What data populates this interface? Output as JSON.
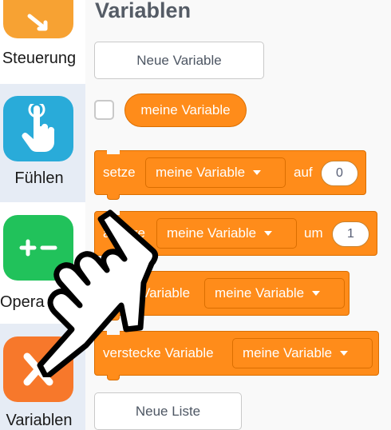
{
  "categories": [
    {
      "label": "Steuerung",
      "color": "#f7a233",
      "icon": "control-icon"
    },
    {
      "label": "Fühlen",
      "color": "#29abd9",
      "icon": "touch-icon"
    },
    {
      "label": "Operatoren",
      "label_visible": "Opera",
      "color": "#21c25b",
      "icon": "operators-icon"
    },
    {
      "label": "Variablen",
      "color": "#f7782b",
      "icon": "variables-icon"
    }
  ],
  "palette": {
    "heading": "Variablen",
    "new_variable_button": "Neue Variable",
    "variable_reporter": "meine Variable",
    "blocks": {
      "set": {
        "label": "setze",
        "variable": "meine Variable",
        "connector": "auf",
        "value": "0"
      },
      "change": {
        "label": "ändere",
        "variable": "meine Variable",
        "connector": "um",
        "value": "1"
      },
      "show": {
        "label": "zeige Variable",
        "label_visible": "Variable",
        "variable": "meine Variable"
      },
      "hide": {
        "label": "verstecke Variable",
        "variable": "meine Variable"
      }
    },
    "new_list_button": "Neue Liste"
  },
  "colors": {
    "block_orange": "#ff8c1a",
    "block_border": "#db6e00",
    "sidebar_active": "#e6ecf5"
  }
}
